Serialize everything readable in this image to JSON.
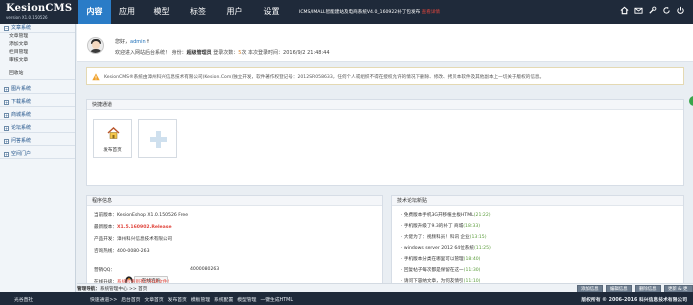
{
  "app": {
    "brand": "KesionCMS",
    "version": "version X1.0.150526",
    "ticker_text": "ICMS/IMALL智能建站及电商系统V4.0_160922补丁包发布",
    "ticker_red": "查看详情"
  },
  "nav": {
    "tabs": [
      "内容",
      "应用",
      "模型",
      "标签",
      "用户",
      "设置"
    ],
    "active": "内容"
  },
  "top_icons": [
    "home-icon",
    "mail-icon",
    "tools-icon",
    "refresh-icon",
    "power-icon"
  ],
  "sidebar": {
    "group_doc": "文章系统",
    "doc_items": [
      "文章管理",
      "添加文章",
      "栏目管理",
      "审核文章"
    ],
    "recycle": "回收站",
    "groups": [
      "图片系统",
      "下载系统",
      "商城系统",
      "论坛系统",
      "问答系统",
      "空间门户"
    ]
  },
  "user": {
    "hello": "您好，",
    "username": "admin",
    "welcome": "欢迎进入网站后台系统！",
    "role_label": "身份：",
    "role": "超级管理员",
    "logins_label": "登录次数：",
    "logins": "5",
    "last_login_label": "次 本次登录时间：",
    "last_login": "2016/9/2 21:48:44"
  },
  "notice": {
    "text": "KesionCMS®系统由漳州科兴信息技术有限公司(Kesion.Com)独立开发，软件著作权登记号：2012SR058633，任何个人或组织不得在授权允许的情况下删除、修改、拷贝本软件及其他副本上一切关于版权的信息。"
  },
  "quick": {
    "title": "快捷通道",
    "items": [
      {
        "label": "发布首页"
      },
      {
        "label": ""
      }
    ]
  },
  "program_info": {
    "title": "程序信息",
    "rows": [
      {
        "label": "当前版本：",
        "value": "KesionEshop X1.0.150526 Free"
      },
      {
        "label": "最新版本：",
        "value": "X1.5.160902.Release"
      },
      {
        "label": "产品开发：",
        "value": "漳州科兴信息技术有限公司"
      },
      {
        "label": "咨询热线：",
        "value": "400-0080-263"
      },
      {
        "label": "营销QQ：",
        "value": "4000080263"
      },
      {
        "label": "在线升级：",
        "value": "系统检查到有可升级文件!"
      }
    ],
    "qq_button": "在线咨询"
  },
  "news": {
    "title": "技术论坛新贴",
    "items": [
      {
        "text": "免费版本手机3G开移植主板HTML",
        "date": "(21:22)"
      },
      {
        "text": "手机版升级了9.3的补丁 商城",
        "date": "(18:33)"
      },
      {
        "text": "大佬为了：视频科员！科讯 企业",
        "date": "(13:15)"
      },
      {
        "text": "windows server 2012 64位系统",
        "date": "(11:25)"
      },
      {
        "text": "手机版本分类在哪里可以管理",
        "date": "(18:40)"
      },
      {
        "text": "回复帖子每次都是保留在这一",
        "date": "(11:30)"
      },
      {
        "text": "请问下容纳文章，为何友情引",
        "date": "(11:10)"
      }
    ]
  },
  "toolbar": {
    "crumb_label": "管理导航：",
    "crumb_path": "系统管理中心 >> 首页",
    "buttons": [
      "添加信息",
      "编辑信息",
      "删除信息",
      "更新 & 更新"
    ]
  },
  "footer": {
    "left": "光谷直社",
    "links": [
      "快速通道>>",
      "后台首页",
      "文章首页",
      "发布首页",
      "模板管理",
      "系统配置",
      "模型管理",
      "一键生成HTML"
    ],
    "right": "版权所有 © 2006-2016 科兴信息技术有限公司"
  }
}
